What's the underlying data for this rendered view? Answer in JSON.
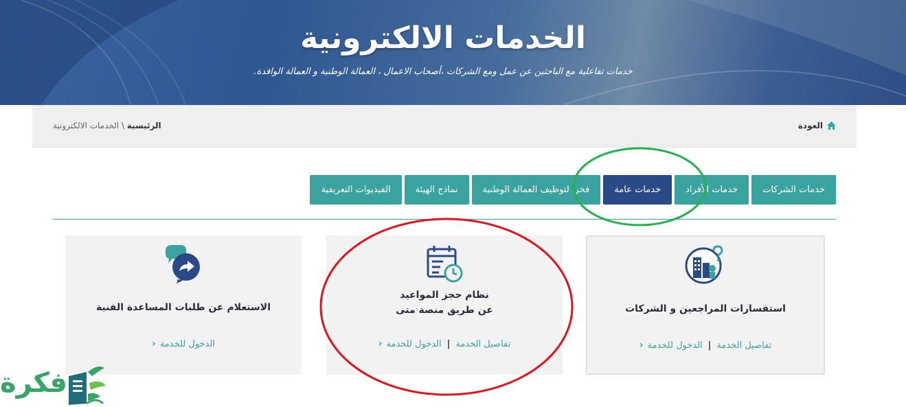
{
  "hero": {
    "title": "الخدمات الالكترونية",
    "subtitle": "خدمات تفاعلية مع الباحثين عن عمل ومع الشركات ،أصحاب الاعمال ، العمالة الوطنية و العمالة الوافدة."
  },
  "breadcrumb": {
    "back_label": "العودة",
    "home_label": "الرئيسية",
    "separator": " \\ ",
    "current": "الخدمات الالكترونية"
  },
  "tabs": [
    {
      "label": "خدمات الشركات",
      "active": false
    },
    {
      "label": "خدمات الأفراد",
      "active": false
    },
    {
      "label": "خدمات عامة",
      "active": true
    },
    {
      "label": "فخرا لتوظيف العمالة الوطنية",
      "active": false
    },
    {
      "label": "نماذج الهيئة",
      "active": false
    },
    {
      "label": "الفيديوات التعريفية",
      "active": false
    }
  ],
  "cards": [
    {
      "icon": "city-question-icon",
      "title": "استفسارات المراجعين و الشركات",
      "details_label": "تفاصيل الخدمة",
      "enter_label": "الدخول للخدمة"
    },
    {
      "icon": "calendar-clock-icon",
      "title_line1": "نظام حجز المواعيد",
      "title_line2": "عن طريق منصة متى",
      "details_label": "تفاصيل الخدمة",
      "enter_label": "الدخول للخدمة"
    },
    {
      "icon": "chat-bubble-icon",
      "title": "الاستعلام عن طلبات المساعدة الفنية",
      "enter_label": "الدخول للخدمة"
    }
  ],
  "watermark": {
    "text": "فكرة"
  },
  "colors": {
    "teal": "#3aa3a0",
    "navy": "#2a4a87",
    "annotation_green": "#22b14c",
    "annotation_red": "#e3131b"
  }
}
